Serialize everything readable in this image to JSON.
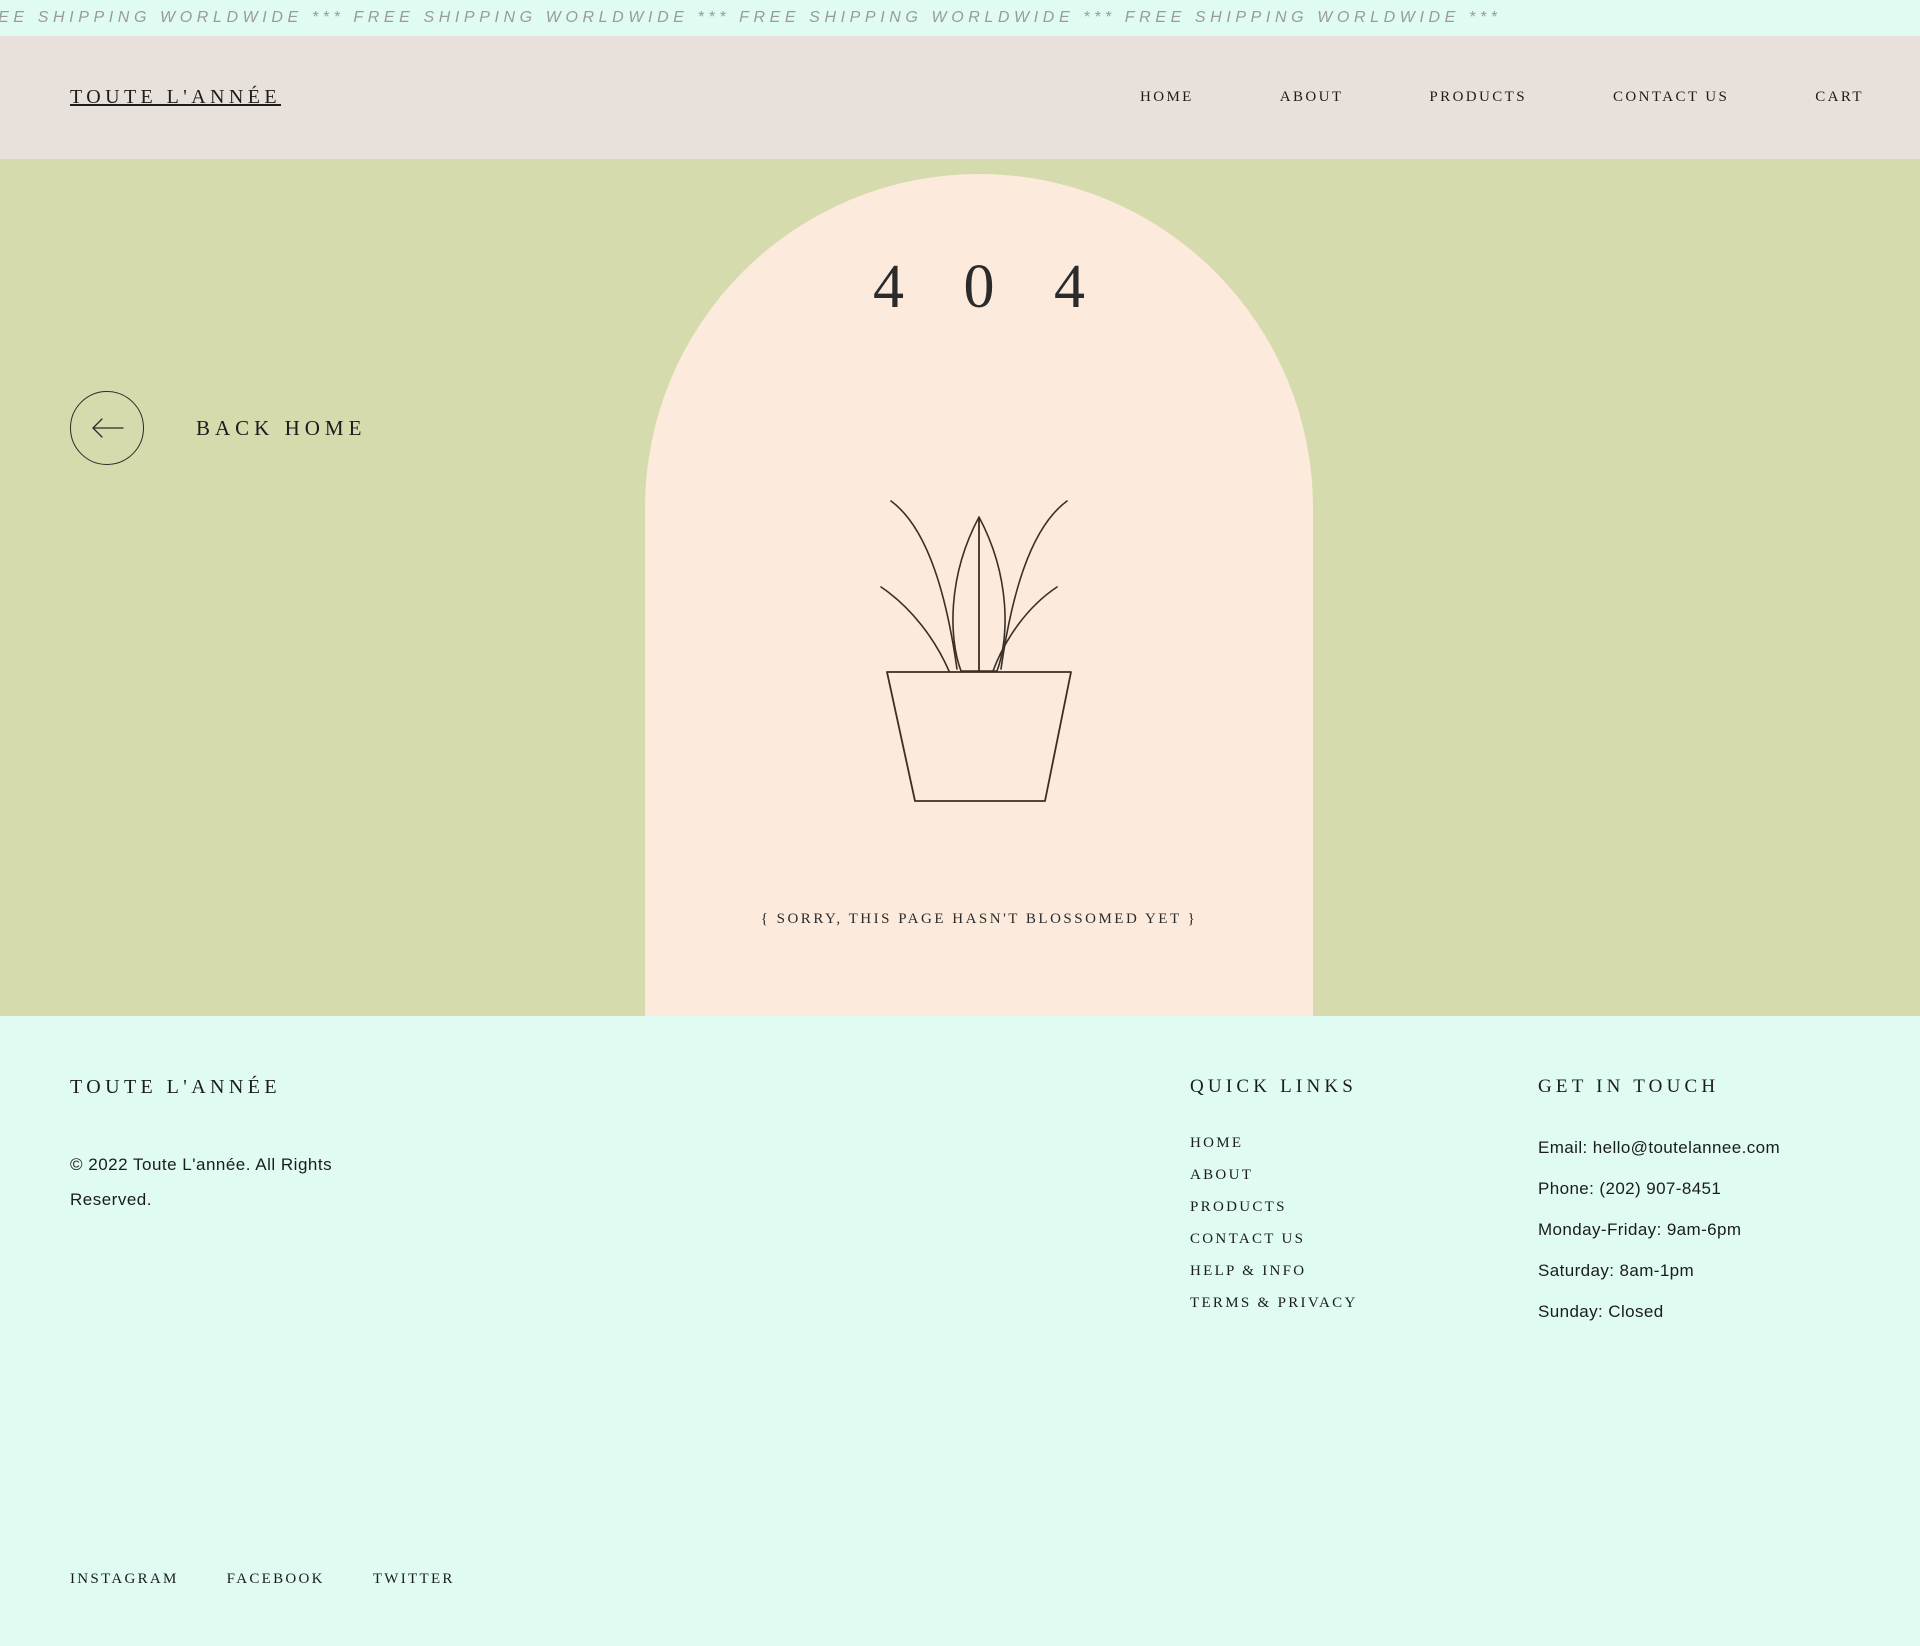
{
  "announcement": {
    "text": "REE SHIPPING WORLDWIDE *** FREE SHIPPING WORLDWIDE *** FREE SHIPPING WORLDWIDE *** FREE SHIPPING WORLDWIDE ***",
    "background": "#dffbf2",
    "color": "#9a9a9a"
  },
  "header": {
    "brand": "TOUTE L'ANNÉE",
    "background": "#e8e0da",
    "nav": [
      {
        "label": "HOME"
      },
      {
        "label": "ABOUT"
      },
      {
        "label": "PRODUCTS"
      },
      {
        "label": "CONTACT US"
      },
      {
        "label": "CART"
      }
    ]
  },
  "hero": {
    "background": "#d6dbae",
    "arch_color": "#fcebdd",
    "back_home_label": "BACK HOME",
    "back_home_icon": "arrow-left-icon",
    "error_code": "4 0 4",
    "error_message": "{ SORRY, THIS PAGE HASN'T BLOSSOMED YET }",
    "illustration": "potted-plant-icon"
  },
  "footer": {
    "background": "#dffbf2",
    "brand": "TOUTE L'ANNÉE",
    "copyright": "© 2022 Toute L'année. All Rights Reserved.",
    "quick_links": {
      "title": "QUICK LINKS",
      "items": [
        {
          "label": "HOME"
        },
        {
          "label": "ABOUT"
        },
        {
          "label": "PRODUCTS"
        },
        {
          "label": "CONTACT US"
        },
        {
          "label": "HELP & INFO"
        },
        {
          "label": "TERMS & PRIVACY"
        }
      ]
    },
    "get_in_touch": {
      "title": "GET IN TOUCH",
      "items": [
        {
          "label": "Email: hello@toutelannee.com"
        },
        {
          "label": "Phone: (202) 907-8451"
        },
        {
          "label": "Monday-Friday: 9am-6pm"
        },
        {
          "label": "Saturday: 8am-1pm"
        },
        {
          "label": "Sunday: Closed"
        }
      ]
    },
    "social": [
      {
        "label": "INSTAGRAM"
      },
      {
        "label": "FACEBOOK"
      },
      {
        "label": "TWITTER"
      }
    ]
  }
}
